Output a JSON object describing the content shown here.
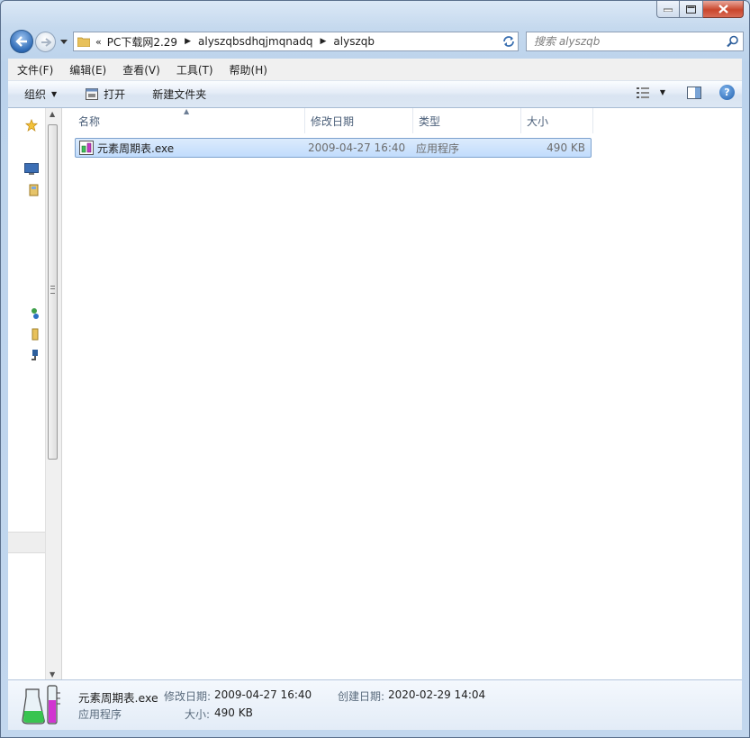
{
  "window": {
    "caption_buttons": {
      "minimize": "minimize-icon",
      "maximize": "maximize-icon",
      "close": "close-icon"
    }
  },
  "navigation": {
    "breadcrumb": [
      "PC下载网2.29",
      "alyszqbsdhqjmqnadq",
      "alyszqb"
    ],
    "overflow_glyph": "«",
    "search_placeholder": "搜索 alyszqb"
  },
  "menu": [
    "文件(F)",
    "编辑(E)",
    "查看(V)",
    "工具(T)",
    "帮助(H)"
  ],
  "commands": {
    "organize": "组织",
    "open": "打开",
    "new_folder": "新建文件夹"
  },
  "columns": [
    "名称",
    "修改日期",
    "类型",
    "大小"
  ],
  "files": [
    {
      "name": "元素周期表.exe",
      "modified": "2009-04-27 16:40",
      "type": "应用程序",
      "size": "490 KB",
      "selected": true
    }
  ],
  "details": {
    "filename": "元素周期表.exe",
    "type": "应用程序",
    "modified_label": "修改日期:",
    "modified_value": "2009-04-27 16:40",
    "created_label": "创建日期:",
    "created_value": "2020-02-29 14:04",
    "size_label": "大小:",
    "size_value": "490 KB"
  },
  "colors": {
    "accent": "#2f6bb6",
    "selection": "#c1dcfc",
    "selection_border": "#7da2ce"
  }
}
